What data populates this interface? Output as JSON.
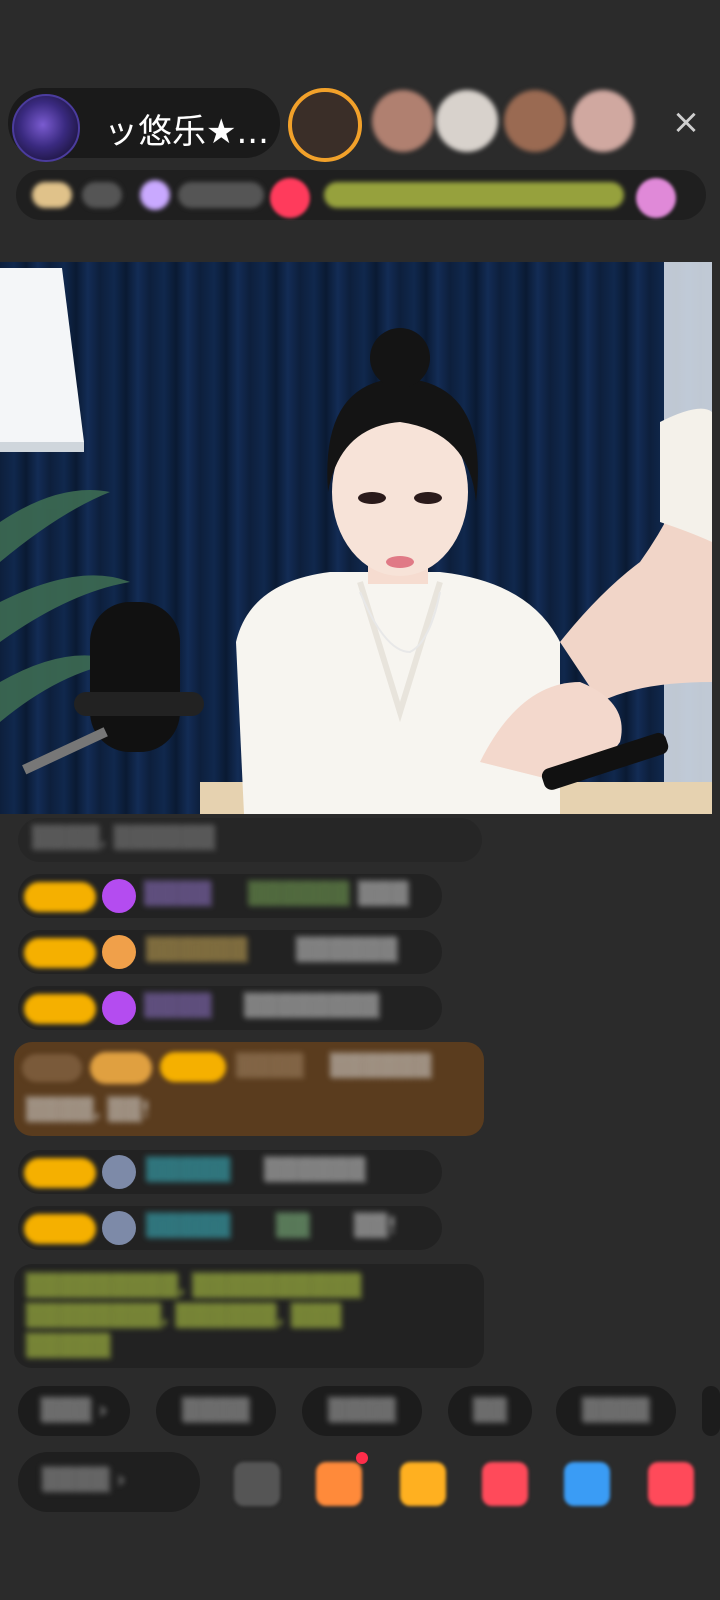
{
  "header": {
    "anchor_name": "ッ悠乐★...",
    "close_icon": "×"
  },
  "colors": {
    "background": "#2b2b2b",
    "badge": "#f5b000",
    "gem": "#b44cf0",
    "link_cyan": "#3ec7d6",
    "lime_text": "#c8e24a"
  }
}
